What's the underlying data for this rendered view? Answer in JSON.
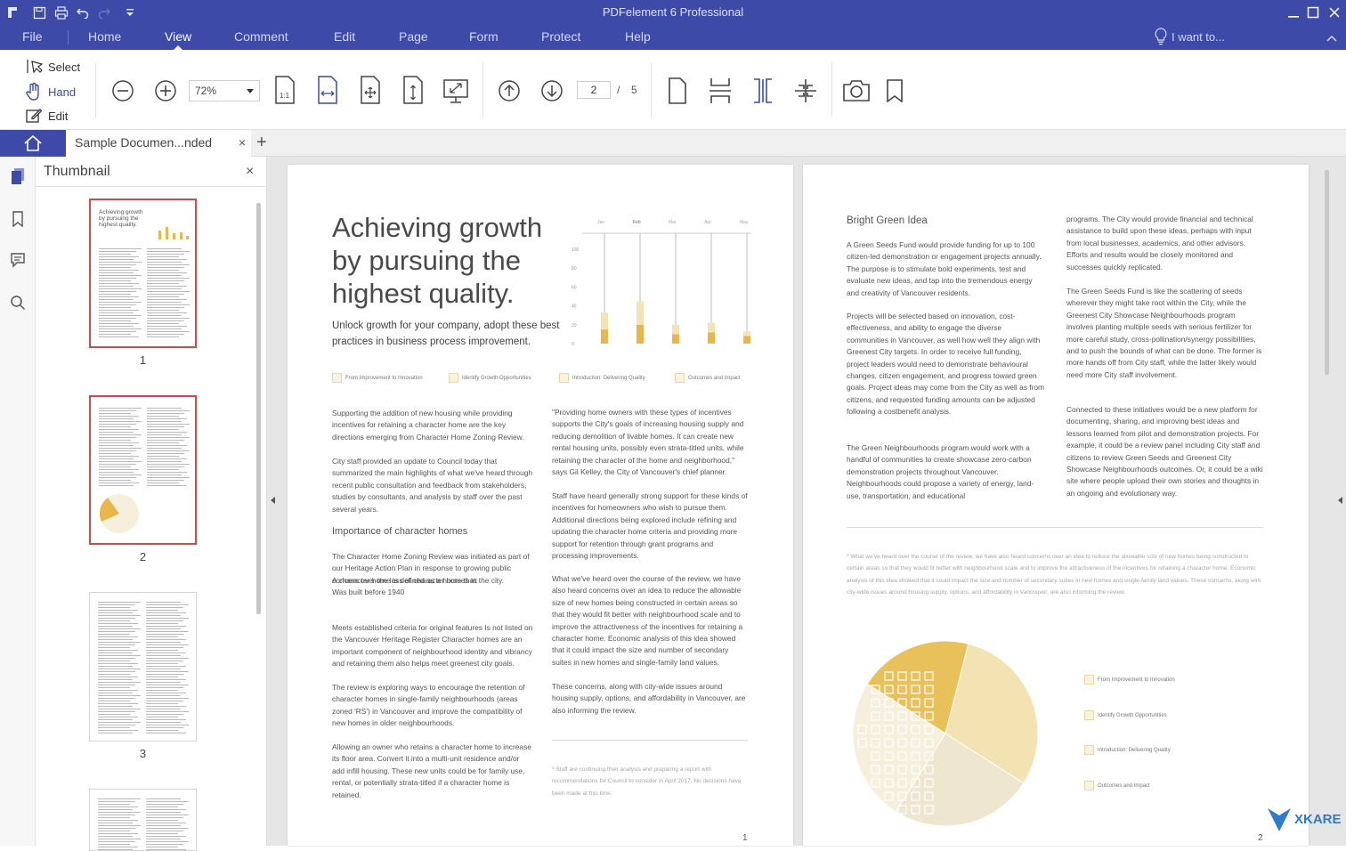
{
  "app": {
    "title": "PDFelement 6 Professional",
    "accent": "#3e4aa8"
  },
  "menu": {
    "items": [
      {
        "label": "File"
      },
      {
        "label": "Home"
      },
      {
        "label": "View"
      },
      {
        "label": "Comment"
      },
      {
        "label": "Edit"
      },
      {
        "label": "Page"
      },
      {
        "label": "Form"
      },
      {
        "label": "Protect"
      },
      {
        "label": "Help"
      }
    ],
    "active": "View",
    "search_label": "I want to..."
  },
  "toolbar": {
    "modes": [
      {
        "label": "Select",
        "icon": "cursor-icon"
      },
      {
        "label": "Hand",
        "icon": "hand-icon"
      },
      {
        "label": "Edit",
        "icon": "edit-icon"
      }
    ],
    "zoom_value": "72%",
    "page_current": "2",
    "page_separator": "/",
    "page_total": "5"
  },
  "tabs": {
    "doc_title": "Sample Documen...nded",
    "close_label": "×",
    "new_tab_label": "+"
  },
  "thumbnails": {
    "title": "Thumbnail",
    "close_label": "×",
    "pages": [
      {
        "number": "1",
        "selected": true,
        "caption": "Achieving growth by pursuing the highest quality."
      },
      {
        "number": "2",
        "selected": true
      },
      {
        "number": "3",
        "selected": false
      }
    ]
  },
  "page1": {
    "heading": "Achieving growth by pursuing the highest quality.",
    "subheading": "Unlock growth for your company, adopt these best practices in business process improvement.",
    "tags": [
      "From Improvement to Innovation",
      "Identify Growth Opportunities",
      "Introduction: Delivering Quality",
      "Outcomes and Impact"
    ],
    "col1": {
      "p1": "Supporting the addition of new housing while providing incentives for retaining a character home are the key directions emerging from Character Home Zoning Review.",
      "p2": "City staff provided an update to Council today that summarized the main highlights of what we've heard through recent public consultation and feedback from stakeholders, studies by consultants, and analysis by staff over the past several years.",
      "section": "Importance of character homes",
      "p3": "The Character Home Zoning Review was initiated as part of our Heritage Action Plan in response to growing public concern over the loss of character homes in the city.",
      "p3b": "A character home is defined as a home that:",
      "p3c": "Was built before 1940",
      "p4": "Meets established criteria for original features Is not listed on the Vancouver Heritage Register Character homes are an important component of neighbourhood identity and vibrancy and retaining them also helps meet greenest city goals.",
      "p5": "The review is exploring ways to encourage the retention of character homes in single-family neighbourhoods (areas zoned 'RS') in Vancouver and improve the compatibility of new homes in older neighbourhoods.",
      "p6": "Allowing an owner who retains a character home to increase its floor area. Convert it into a multi-unit residence and/or add infill housing. These new units could be for family use, rental, or potentially strata-titled if a character home is retained."
    },
    "col2": {
      "p1": "\"Providing home owners with these types of incentives supports the City's goals of increasing housing supply and reducing demolition of livable homes. It can create new rental housing units, possibly even strata-titled units, while retaining the character of the home and neighborhood,\" says Gil Kelley, the City of Vancouver's chief planner.",
      "p2": "Staff have heard generally strong support for these kinds of incentives for homeowners who wish to pursue them. Additional directions being explored include refining and updating the character home criteria and providing more support for retention through grant programs and processing improvements.",
      "p3": "What we've heard over the course of the review, we have also heard concerns over an idea to reduce the allowable size of new homes being constructed in certain areas so that they would fit better with neighbourhood scale and to improve the attractiveness of the incentives for retaining a character home. Economic analysis of this idea showed that it could impact the size and number of secondary suites in new homes and single-family land values.",
      "p4": "These concerns, along with city-wide issues around housing supply, options, and affordability in Vancouver, are also informing the review.",
      "foot": "* Staff are continuing their analysis and preparing a report with recommendations for Council to consider in April 2017. No decisions have been made at this time."
    },
    "page_number": "1"
  },
  "page2": {
    "heading": "Bright Green Idea",
    "col1": {
      "p1": "A Green Seeds Fund would provide funding for up to 100 citizen-led demonstration or engagement projects annually. The purpose is to stimulate bold experiments, test and evaluate new ideas, and tap into the tremendous energy and creativity of Vancouver residents.",
      "p2": "Projects will be selected based on innovation, cost-effectiveness, and ability to engage the diverse communities in Vancouver, as well how well they align with Greenest City targets. In order to receive full funding, project leaders would need to demonstrate behavioural changes, citizen engagement, and progress toward green goals. Project ideas may come from the City as well as from citizens, and requested funding amounts can be adjusted following a costbenefit analysis.",
      "p3": "The Green Neighbourhoods program would work with a handful of communities to create showcase zero-carbon demonstration projects throughout Vancouver. Neighbourhoods could propose a variety of energy, land-use, transportation, and educational"
    },
    "col2": {
      "p1": "programs. The City would provide financial and technical assistance to build upon these ideas, perhaps with input from local businesses, academics, and other advisors. Efforts and results would be closely monitored and successes quickly replicated.",
      "p2": "The Green Seeds Fund is like the scattering of seeds wherever they might take root within the City, while the Greenest City Showcase Neighbourhoods program involves planting multiple seeds with serious fertilizer for more careful study, cross-pollination/synergy possibilities, and to push the bounds of what can be done. The former is more hands off from City staff, while the latter likely would need more City staff involvement.",
      "p3": "Connected to these initiatives would be a new platform for documenting, sharing, and improving best ideas and lessons learned from pilot and demonstration projects. For example, it could be a review panel including City staff and citizens to review Green Seeds and Greenest City Showcase Neighbourhoods outcomes. Or, it could be a wiki site where people upload their own stories and thoughts in an ongoing and evolutionary way."
    },
    "note": "* What we've heard over the course of the review, we have also heard concerns over an idea to reduce the allowable size of new homes being constructed in certain areas so that they would fit better with neighbourhood scale and to improve the attractiveness of the incentives for retaining a character home. Economic analysis of this idea showed that it could impact the size and number of secondary suites in new homes and single-family land values. These concerns, along with city-wide issues around housing supply, options, and affordability in Vancouver, are also informing the review.",
    "legend": [
      "From Improvement to Innovation",
      "Identify Growth Opportunities",
      "Introduction: Delivering Quality",
      "Outcomes and Impact"
    ],
    "page_number": "2"
  },
  "chart_data": [
    {
      "type": "bar",
      "categories": [
        "Jan",
        "Feb",
        "Mar",
        "Apr",
        "May"
      ],
      "series": [
        {
          "values": [
            15,
            20,
            10,
            12,
            8
          ]
        },
        {
          "values": [
            18,
            25,
            10,
            10,
            5
          ]
        }
      ],
      "stacked": true,
      "ylim": [
        0,
        100
      ],
      "yticks": [
        "0",
        "20",
        "40",
        "60",
        "80",
        "100"
      ],
      "colors": [
        "#e8b64a",
        "#f6e3b4"
      ]
    },
    {
      "type": "pie",
      "values": [
        20,
        30,
        25,
        25
      ],
      "colors": [
        "#e8c15a",
        "#f3e2b2",
        "#efe6cf",
        "#f6efdc"
      ]
    }
  ],
  "watermark": {
    "brand": "XKARE"
  }
}
